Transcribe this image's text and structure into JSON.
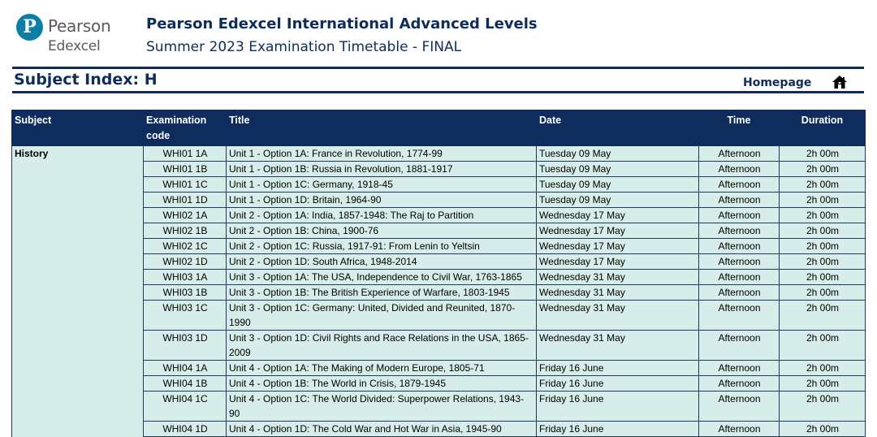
{
  "logo": {
    "brand": "Pearson",
    "sub": "Edexcel",
    "color": "#0b7fa6"
  },
  "header": {
    "title": "Pearson Edexcel International Advanced Levels",
    "subtitle": "Summer 2023 Examination Timetable - FINAL"
  },
  "index": {
    "title": "Subject Index: H",
    "homepage_label": "Homepage",
    "home_icon": "home-icon"
  },
  "table": {
    "columns": [
      "Subject",
      "Examination code",
      "Title",
      "Date",
      "Time",
      "Duration"
    ],
    "subject": "History",
    "rows": [
      {
        "code": "WHI01 1A",
        "title": "Unit 1 - Option 1A: France in Revolution, 1774-99",
        "date": "Tuesday 09 May",
        "time": "Afternoon",
        "duration": "2h 00m"
      },
      {
        "code": "WHI01 1B",
        "title": "Unit 1 - Option 1B: Russia in Revolution, 1881-1917",
        "date": "Tuesday 09 May",
        "time": "Afternoon",
        "duration": "2h 00m"
      },
      {
        "code": "WHI01 1C",
        "title": "Unit 1 - Option 1C: Germany, 1918-45",
        "date": "Tuesday 09 May",
        "time": "Afternoon",
        "duration": "2h 00m"
      },
      {
        "code": "WHI01 1D",
        "title": "Unit 1 - Option 1D: Britain, 1964-90",
        "date": "Tuesday 09 May",
        "time": "Afternoon",
        "duration": "2h 00m"
      },
      {
        "code": "WHI02 1A",
        "title": "Unit 2 - Option 1A: India, 1857-1948: The Raj to Partition",
        "date": "Wednesday 17 May",
        "time": "Afternoon",
        "duration": "2h 00m"
      },
      {
        "code": "WHI02 1B",
        "title": "Unit 2 - Option 1B: China, 1900-76",
        "date": "Wednesday 17 May",
        "time": "Afternoon",
        "duration": "2h 00m"
      },
      {
        "code": "WHI02 1C",
        "title": "Unit 2 - Option 1C: Russia, 1917-91: From Lenin to Yeltsin",
        "date": "Wednesday 17 May",
        "time": "Afternoon",
        "duration": "2h 00m"
      },
      {
        "code": "WHI02 1D",
        "title": "Unit 2 - Option 1D: South Africa, 1948-2014",
        "date": "Wednesday 17 May",
        "time": "Afternoon",
        "duration": "2h 00m"
      },
      {
        "code": "WHI03 1A",
        "title": "Unit 3 - Option 1A: The USA, Independence to Civil War, 1763-1865",
        "date": "Wednesday 31 May",
        "time": "Afternoon",
        "duration": "2h 00m"
      },
      {
        "code": "WHI03 1B",
        "title": "Unit 3 - Option 1B: The British Experience of Warfare, 1803-1945",
        "date": "Wednesday 31 May",
        "time": "Afternoon",
        "duration": "2h 00m"
      },
      {
        "code": "WHI03 1C",
        "title": "Unit 3 - Option 1C: Germany: United, Divided and Reunited, 1870-1990",
        "date": "Wednesday 31 May",
        "time": "Afternoon",
        "duration": "2h 00m"
      },
      {
        "code": "WHI03 1D",
        "title": "Unit 3 - Option 1D: Civil Rights and Race Relations in the USA, 1865-2009",
        "date": "Wednesday 31 May",
        "time": "Afternoon",
        "duration": "2h 00m"
      },
      {
        "code": "WHI04 1A",
        "title": "Unit 4 - Option 1A: The Making of Modern Europe, 1805-71",
        "date": "Friday 16 June",
        "time": "Afternoon",
        "duration": "2h 00m"
      },
      {
        "code": "WHI04 1B",
        "title": "Unit 4 - Option 1B: The World in Crisis, 1879-1945",
        "date": "Friday 16 June",
        "time": "Afternoon",
        "duration": "2h 00m"
      },
      {
        "code": "WHI04 1C",
        "title": "Unit 4 - Option 1C: The World Divided: Superpower Relations, 1943-90",
        "date": "Friday 16 June",
        "time": "Afternoon",
        "duration": "2h 00m"
      },
      {
        "code": "WHI04 1D",
        "title": "Unit 4 - Option 1D: The Cold War and Hot War in Asia, 1945-90",
        "date": "Friday 16 June",
        "time": "Afternoon",
        "duration": "2h 00m"
      }
    ]
  }
}
